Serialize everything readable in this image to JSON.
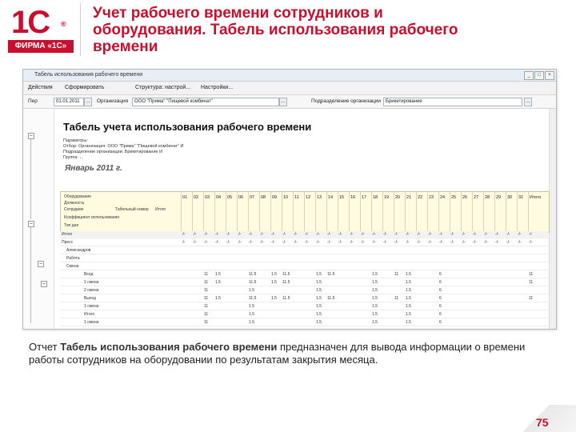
{
  "logo": {
    "mark": "1С",
    "reg": "®",
    "firm": "ФИРМА «1С»"
  },
  "slide": {
    "title": "Учет рабочего времени сотрудников и оборудования. Табель использования рабочего времени",
    "description_prefix": "Отчет ",
    "description_bold": "Табель использования рабочего времени",
    "description_suffix": " предназначен для вывода информации о времени работы сотрудников на оборудовании по результатам закрытия месяца.",
    "page_number": "75"
  },
  "window": {
    "title": "Табель использования рабочего времени",
    "controls": [
      "_",
      "□",
      "×"
    ]
  },
  "toolbar": {
    "actions_label": "Действия",
    "generate_label": "Сформировать",
    "structure_label": "Структура: настрой...",
    "settings_label": "Настройки..."
  },
  "params": {
    "period_label": "Пер",
    "period_value": "01.01.2011",
    "org_label": "Организация",
    "org_value": "ООО \"Прима\" \"Пищевой комбинат\"",
    "division_label": "Подразделение организации",
    "division_value": "Брикетирование"
  },
  "report": {
    "title": "Табель учета использования рабочего времени",
    "meta": [
      "Параметры:",
      "Отбор:        Организация: ООО \"Прима\" \"Пищевой комбинат\" И",
      "               Подразделение организации: Брикетирование И",
      "               Группа: ..."
    ],
    "month": "Январь 2011 г.",
    "head_labels": [
      "Оборудование",
      "Должность",
      "Сотрудник",
      "Табельный номер",
      "Итого",
      "Коэффициент использования",
      "Тип дня"
    ],
    "days": [
      "01",
      "02",
      "03",
      "04",
      "05",
      "06",
      "07",
      "08",
      "09",
      "10",
      "11",
      "12",
      "13",
      "14",
      "15",
      "16",
      "17",
      "18",
      "19",
      "20",
      "21",
      "22",
      "23",
      "24",
      "25",
      "26",
      "27",
      "28",
      "29",
      "30",
      "31",
      "Итого"
    ],
    "rows": [
      {
        "name": "Итого",
        "cells": [
          "-/-",
          "-/-",
          "-/-",
          "-/-",
          "-/-",
          "-/-",
          "-/-",
          "-/-",
          "-/-",
          "-/-",
          "-/-",
          "-/-",
          "-/-",
          "-/-",
          "-/-",
          "-/-",
          "-/-",
          "-/-",
          "-/-",
          "-/-",
          "-/-",
          "-/-",
          "-/-",
          "-/-",
          "-/-",
          "-/-",
          "-/-",
          "-/-",
          "-/-",
          "-/-",
          "-/-",
          "-/-"
        ]
      },
      {
        "name": "Пресс",
        "cells": [
          "-/-",
          "-/-",
          "-/-",
          "-/-",
          "-/-",
          "-/-",
          "-/-",
          "-/-",
          "-/-",
          "-/-",
          "-/-",
          "-/-",
          "-/-",
          "-/-",
          "-/-",
          "-/-",
          "-/-",
          "-/-",
          "-/-",
          "-/-",
          "-/-",
          "-/-",
          "-/-",
          "-/-",
          "-/-",
          "-/-",
          "-/-",
          "-/-",
          "-/-",
          "-/-",
          "-/-",
          "-/-"
        ]
      },
      {
        "name": "Александров",
        "cells": [
          "",
          "",
          "",
          "",
          "",
          "",
          "",
          "",
          "",
          "",
          "",
          "",
          "",
          "",
          "",
          "",
          "",
          "",
          "",
          "",
          "",
          "",
          "",
          "",
          "",
          "",
          "",
          "",
          "",
          "",
          "",
          ""
        ]
      },
      {
        "name": "Работа",
        "cells": [
          "",
          "",
          "",
          "",
          "",
          "",
          "",
          "",
          "",
          "",
          "",
          "",
          "",
          "",
          "",
          "",
          "",
          "",
          "",
          "",
          "",
          "",
          "",
          "",
          "",
          "",
          "",
          "",
          "",
          "",
          "",
          ""
        ]
      },
      {
        "name": "Смена",
        "cells": [
          "",
          "",
          "",
          "",
          "",
          "",
          "",
          "",
          "",
          "",
          "",
          "",
          "",
          "",
          "",
          "",
          "",
          "",
          "",
          "",
          "",
          "",
          "",
          "",
          "",
          "",
          "",
          "",
          "",
          "",
          "",
          ""
        ]
      },
      {
        "name": "Вход",
        "cells": [
          "",
          "",
          "11",
          "1.5",
          "",
          "",
          "11.5",
          "",
          "1.5",
          "11.5",
          "",
          "",
          "1.5",
          "11.5",
          "",
          "",
          "",
          "1.5",
          "",
          "11",
          "1.5",
          "",
          "",
          "6",
          "",
          "",
          "",
          "",
          "",
          "",
          "",
          "11"
        ]
      },
      {
        "name": "1 смена",
        "cells": [
          "",
          "",
          "11",
          "1.5",
          "",
          "",
          "11.5",
          "",
          "1.5",
          "11.5",
          "",
          "",
          "1.5",
          "",
          "",
          "",
          "",
          "1.5",
          "",
          "",
          "1.5",
          "",
          "",
          "6",
          "",
          "",
          "",
          "",
          "",
          "",
          "",
          "11"
        ]
      },
      {
        "name": "2 смена",
        "cells": [
          "",
          "",
          "11",
          "",
          "",
          "",
          "1.5",
          "",
          "",
          "",
          "",
          "",
          "1.5",
          "",
          "",
          "",
          "",
          "1.5",
          "",
          "",
          "1.5",
          "",
          "",
          "6",
          "",
          "",
          "",
          "",
          "",
          "",
          "",
          ""
        ]
      },
      {
        "name": "Выход",
        "cells": [
          "",
          "",
          "11",
          "1.5",
          "",
          "",
          "11.5",
          "",
          "1.5",
          "11.5",
          "",
          "",
          "1.5",
          "11.5",
          "",
          "",
          "",
          "1.5",
          "",
          "11",
          "1.5",
          "",
          "",
          "6",
          "",
          "",
          "",
          "",
          "",
          "",
          "",
          "11"
        ]
      },
      {
        "name": "1 смена",
        "cells": [
          "",
          "",
          "11",
          "",
          "",
          "",
          "1.5",
          "",
          "",
          "",
          "",
          "",
          "1.5",
          "",
          "",
          "",
          "",
          "1.5",
          "",
          "",
          "1.5",
          "",
          "",
          "6",
          "",
          "",
          "",
          "",
          "",
          "",
          "",
          ""
        ]
      },
      {
        "name": "Итого",
        "cells": [
          "",
          "",
          "11",
          "",
          "",
          "",
          "1.5",
          "",
          "",
          "",
          "",
          "",
          "1.5",
          "",
          "",
          "",
          "",
          "1.5",
          "",
          "",
          "1.5",
          "",
          "",
          "6",
          "",
          "",
          "",
          "",
          "",
          "",
          "",
          ""
        ]
      },
      {
        "name": "1 смена",
        "cells": [
          "",
          "",
          "11",
          "",
          "",
          "",
          "1.5",
          "",
          "",
          "",
          "",
          "",
          "1.5",
          "",
          "",
          "",
          "",
          "1.5",
          "",
          "",
          "1.5",
          "",
          "",
          "6",
          "",
          "",
          "",
          "",
          "",
          "",
          "",
          ""
        ]
      }
    ]
  }
}
